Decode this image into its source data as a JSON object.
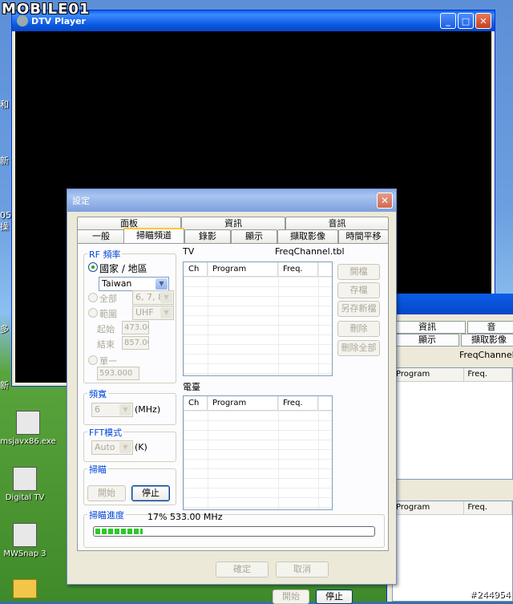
{
  "watermark_logo": "MOBILE01",
  "watermark_id": "#244954",
  "desktop": {
    "left_edge_chars": [
      "和",
      "新",
      "05",
      "操",
      "多",
      "新"
    ],
    "icons": [
      {
        "name": "msjavx86.exe"
      },
      {
        "name": "Digital TV"
      },
      {
        "name": "MWSnap 3"
      }
    ]
  },
  "dtv_window": {
    "title": "DTV Player"
  },
  "background_window": {
    "tabs": [
      "資訊",
      "音",
      "顯示",
      "擷取影像"
    ],
    "file": "FreqChannel.tb",
    "cols": [
      "Program",
      "Freq."
    ],
    "buttons": [
      "開始",
      "停止"
    ]
  },
  "dialog": {
    "title": "設定",
    "tabs_row1": [
      "面板",
      "資訊",
      "音訊"
    ],
    "tabs_row2": [
      "一般",
      "掃瞄頻道",
      "錄影",
      "顯示",
      "擷取影像",
      "時間平移"
    ],
    "rf": {
      "label": "RF 頻率",
      "country_label": "國家 / 地區",
      "country_value": "Taiwan",
      "all_label": "全部",
      "all_value": "6, 7, 8",
      "range_label": "範圍",
      "range_value": "UHF",
      "start_label": "起始",
      "start_value": "473.00",
      "end_label": "結束",
      "end_value": "857.00",
      "single_label": "單一",
      "single_value": "593.000"
    },
    "bandwidth": {
      "label": "頻寬",
      "value": "6",
      "unit": "(MHz)"
    },
    "fft": {
      "label": "FFT模式",
      "value": "Auto",
      "unit": "(K)"
    },
    "scan": {
      "label": "掃瞄",
      "start": "開始",
      "stop": "停止"
    },
    "tv_list": {
      "label": "TV",
      "file": "FreqChannel.tbl",
      "cols": [
        "Ch",
        "Program",
        "Freq."
      ]
    },
    "radio_list": {
      "label": "電臺",
      "cols": [
        "Ch",
        "Program",
        "Freq."
      ]
    },
    "side_buttons": [
      "開檔",
      "存檔",
      "另存新檔",
      "刪除",
      "刪除全部"
    ],
    "progress": {
      "label": "掃瞄進度",
      "text": "17% 533.00 MHz",
      "percent": 17
    },
    "ok": "確定",
    "cancel": "取消"
  }
}
